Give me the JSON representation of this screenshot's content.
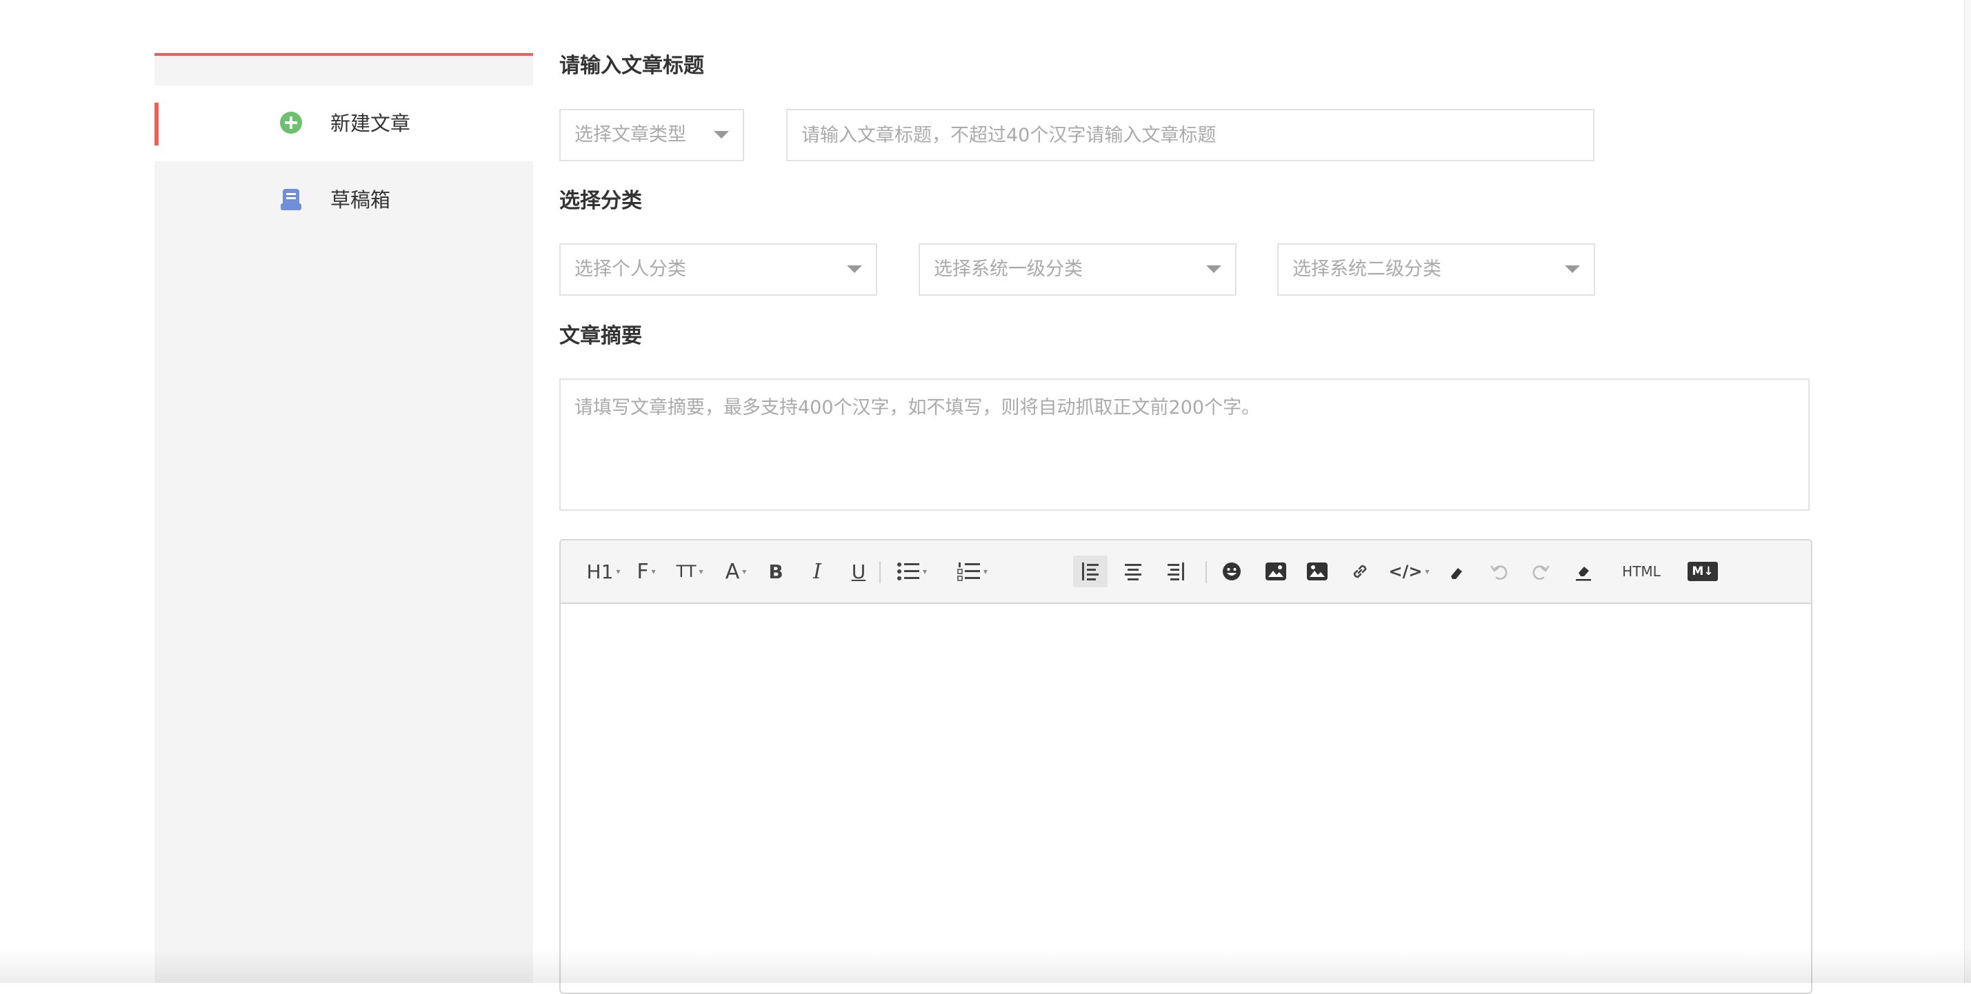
{
  "sidebar": {
    "items": [
      {
        "label": "新建文章",
        "icon": "plus-circle-icon",
        "active": true
      },
      {
        "label": "草稿箱",
        "icon": "drafts-icon",
        "active": false
      }
    ]
  },
  "form": {
    "title_section": {
      "heading": "请输入文章标题",
      "type_select_placeholder": "选择文章类型",
      "title_input_placeholder": "请输入文章标题，不超过40个汉字请输入文章标题",
      "title_input_value": ""
    },
    "category_section": {
      "heading": "选择分类",
      "personal_placeholder": "选择个人分类",
      "system_level1_placeholder": "选择系统一级分类",
      "system_level2_placeholder": "选择系统二级分类"
    },
    "summary_section": {
      "heading": "文章摘要",
      "summary_placeholder": "请填写文章摘要，最多支持400个汉字，如不填写，则将自动抓取正文前200个字。",
      "summary_value": ""
    }
  },
  "editor": {
    "toolbar": {
      "heading_label": "H1",
      "font_label": "F",
      "font_size_label": "TT",
      "color_label": "A",
      "bold_label": "B",
      "italic_label": "I",
      "underline_label": "U",
      "html_label": "HTML",
      "markdown_label": "M↓",
      "code_label": "</>"
    }
  },
  "colors": {
    "accent": "#e8625b",
    "plus_icon": "#6cc070",
    "drafts_icon": "#6f8fd8",
    "placeholder": "#aaaaaa"
  }
}
